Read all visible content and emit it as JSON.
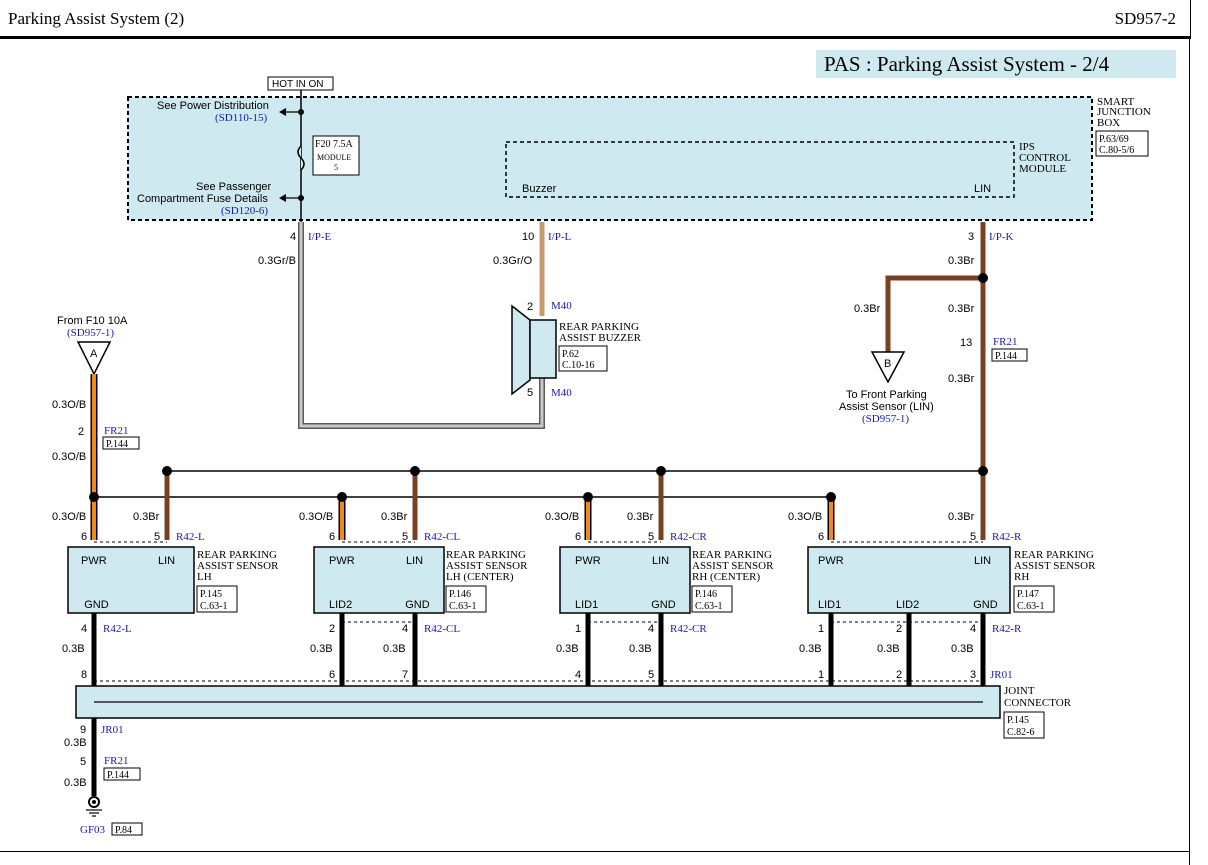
{
  "header": {
    "title": "Parking Assist System (2)",
    "code": "SD957-2"
  },
  "banner": "PAS : Parking Assist System - 2/4",
  "hot_in_on": "HOT IN ON",
  "colors": {
    "panel": "#cfe9f0",
    "brown": "#7a4022",
    "orange": "#f08a1c",
    "gray_wire": "#909090",
    "tan_wire": "#c79a6c",
    "blue_ref": "#1a1aa6"
  },
  "sjb": {
    "label_lines": [
      "SMART",
      "JUNCTION",
      "BOX"
    ],
    "ref_lines": [
      "P.63/69",
      "C.80-5/6"
    ],
    "power_dist_label": "See Power Distribution",
    "power_dist_ref": "(SD110-15)",
    "fuse_label": "F20 7.5A",
    "fuse_module_lines": [
      "MODULE",
      "5"
    ],
    "passenger_lines": [
      "See Passenger",
      "Compartment Fuse Details"
    ],
    "passenger_ref": "(SD120-6)"
  },
  "ips": {
    "label_lines": [
      "IPS",
      "CONTROL",
      "MODULE"
    ],
    "buzzer_pin": "Buzzer",
    "lin_pin": "LIN"
  },
  "connectors": {
    "ip_e": {
      "pin": "4",
      "name": "I/P-E",
      "wire": "0.3Gr/B"
    },
    "ip_l": {
      "pin": "10",
      "name": "I/P-L",
      "wire": "0.3Gr/O"
    },
    "ip_k": {
      "pin": "3",
      "name": "I/P-K",
      "wire": "0.3Br"
    },
    "fr21_right": {
      "pin": "13",
      "name": "FR21",
      "ref": "P.144"
    },
    "fr21_left": {
      "pin": "2",
      "name": "FR21",
      "ref": "P.144"
    },
    "fr21_ground": {
      "pin": "5",
      "name": "FR21",
      "ref": "P.144"
    },
    "jr01": {
      "name": "JR01"
    },
    "gf03": {
      "name": "GF03",
      "ref": "P.84"
    }
  },
  "buzzer": {
    "label_lines": [
      "REAR PARKING",
      "ASSIST BUZZER"
    ],
    "ref_lines": [
      "P.62",
      "C.10-16"
    ],
    "top_pin": "2",
    "bottom_pin": "5",
    "connector": "M40"
  },
  "branch_b": {
    "letter": "B",
    "wire_top": "0.3Br",
    "wire_left": "0.3Br",
    "wire_right": "0.3Br",
    "wire_lower": "0.3Br",
    "label_lines": [
      "To Front Parking",
      "Assist Sensor (LIN)"
    ],
    "ref": "(SD957-1)"
  },
  "source_a": {
    "letter": "A",
    "label": "From F10 10A",
    "ref": "(SD957-1)",
    "wire1": "0.3O/B",
    "wire2": "0.3O/B"
  },
  "sensors": [
    {
      "id": "lh",
      "title_lines": [
        "REAR PARKING",
        "ASSIST SENSOR",
        "LH"
      ],
      "ref_lines": [
        "P.145",
        "C.63-1"
      ],
      "conn": "R42-L",
      "pwr_pin": "6",
      "lin_pin": "5",
      "pwr_wire": "0.3O/B",
      "lin_wire": "0.3Br",
      "pin_labels": {
        "pwr": "PWR",
        "lin": "LIN"
      },
      "bottom": [
        {
          "label": "GND",
          "pin": "4",
          "wire": "0.3B",
          "jc_pin": "8"
        }
      ]
    },
    {
      "id": "lh-center",
      "title_lines": [
        "REAR PARKING",
        "ASSIST SENSOR",
        "LH (CENTER)"
      ],
      "ref_lines": [
        "P.146",
        "C.63-1"
      ],
      "conn": "R42-CL",
      "pwr_pin": "6",
      "lin_pin": "5",
      "pwr_wire": "0.3O/B",
      "lin_wire": "0.3Br",
      "pin_labels": {
        "pwr": "PWR",
        "lin": "LIN"
      },
      "bottom": [
        {
          "label": "LID2",
          "pin": "2",
          "wire": "0.3B",
          "jc_pin": "6"
        },
        {
          "label": "GND",
          "pin": "4",
          "wire": "0.3B",
          "jc_pin": "7"
        }
      ]
    },
    {
      "id": "rh-center",
      "title_lines": [
        "REAR PARKING",
        "ASSIST SENSOR",
        "RH (CENTER)"
      ],
      "ref_lines": [
        "P.146",
        "C.63-1"
      ],
      "conn": "R42-CR",
      "pwr_pin": "6",
      "lin_pin": "5",
      "pwr_wire": "0.3O/B",
      "lin_wire": "0.3Br",
      "pin_labels": {
        "pwr": "PWR",
        "lin": "LIN"
      },
      "bottom": [
        {
          "label": "LID1",
          "pin": "1",
          "wire": "0.3B",
          "jc_pin": "4"
        },
        {
          "label": "GND",
          "pin": "4",
          "wire": "0.3B",
          "jc_pin": "5"
        }
      ]
    },
    {
      "id": "rh",
      "title_lines": [
        "REAR PARKING",
        "ASSIST SENSOR",
        "RH"
      ],
      "ref_lines": [
        "P.147",
        "C.63-1"
      ],
      "conn": "R42-R",
      "pwr_pin": "6",
      "lin_pin": "5",
      "pwr_wire": "0.3O/B",
      "lin_wire": "0.3Br",
      "pin_labels": {
        "pwr": "PWR",
        "lin": "LIN"
      },
      "bottom": [
        {
          "label": "LID1",
          "pin": "1",
          "wire": "0.3B",
          "jc_pin": "1"
        },
        {
          "label": "LID2",
          "pin": "2",
          "wire": "0.3B",
          "jc_pin": "2"
        },
        {
          "label": "GND",
          "pin": "4",
          "wire": "0.3B",
          "jc_pin": "3"
        }
      ]
    }
  ],
  "joint_connector": {
    "label_lines": [
      "JOINT",
      "CONNECTOR"
    ],
    "ref_lines": [
      "P.145",
      "C.82-6"
    ],
    "out_pin": "9",
    "out_wire": "0.3B",
    "ground_wire": "0.3B"
  }
}
